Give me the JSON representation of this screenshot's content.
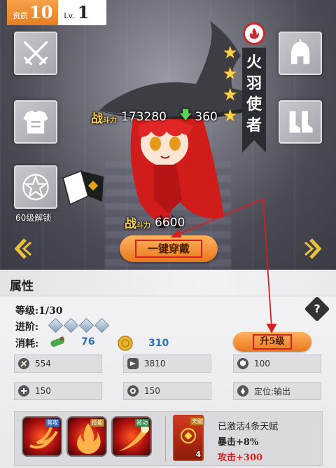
{
  "level": {
    "prefix": "资质",
    "quality": "10",
    "lv_prefix": "Lv.",
    "lv": "1"
  },
  "character": {
    "name_chars": [
      "火",
      "羽",
      "使",
      "者"
    ],
    "element_icon": "fire-icon",
    "stars": 4
  },
  "slots": {
    "left": [
      {
        "name": "weapon-slot",
        "icon": "crossed-swords-icon"
      },
      {
        "name": "armor-slot",
        "icon": "chest-armor-icon"
      },
      {
        "name": "locked-slot",
        "icon": "star-icon",
        "label": "60级解锁"
      }
    ],
    "right": [
      {
        "name": "helmet-slot",
        "icon": "helmet-icon"
      },
      {
        "name": "boots-slot",
        "icon": "boots-icon"
      }
    ]
  },
  "power": {
    "label": "战",
    "label_small": "斗力",
    "total": "173280",
    "delta": "360",
    "equip_power": "6600"
  },
  "buttons": {
    "one_key_equip": "一键穿戴",
    "upgrade_5": "升5级"
  },
  "attributes": {
    "title": "属性",
    "level_label": "等级:",
    "level_value": "1/30",
    "advance_label": "进阶:",
    "advance_count": 4,
    "cost_label": "消耗:",
    "cost_potion": "76",
    "cost_gold": "310",
    "stats": [
      {
        "icon": "attack-icon",
        "value": "554"
      },
      {
        "icon": "defense-icon",
        "value": "3810"
      },
      {
        "icon": "shield-icon",
        "value": "100"
      },
      {
        "icon": "health-icon",
        "value": "150"
      },
      {
        "icon": "gear-icon",
        "value": "150"
      },
      {
        "icon": "role-icon",
        "value": "定位:输出"
      }
    ]
  },
  "skills": [
    {
      "tag": "普攻"
    },
    {
      "tag": "技能"
    },
    {
      "tag": "被动"
    }
  ],
  "talent": {
    "tag": "天赋",
    "count": "4",
    "line1": "已激活4条天赋",
    "line2": "暴击+8%",
    "line3": "攻击+300"
  },
  "colors": {
    "accent": "#e9771d",
    "annotation": "#d61f1f",
    "highlight": "#d61f1f"
  }
}
